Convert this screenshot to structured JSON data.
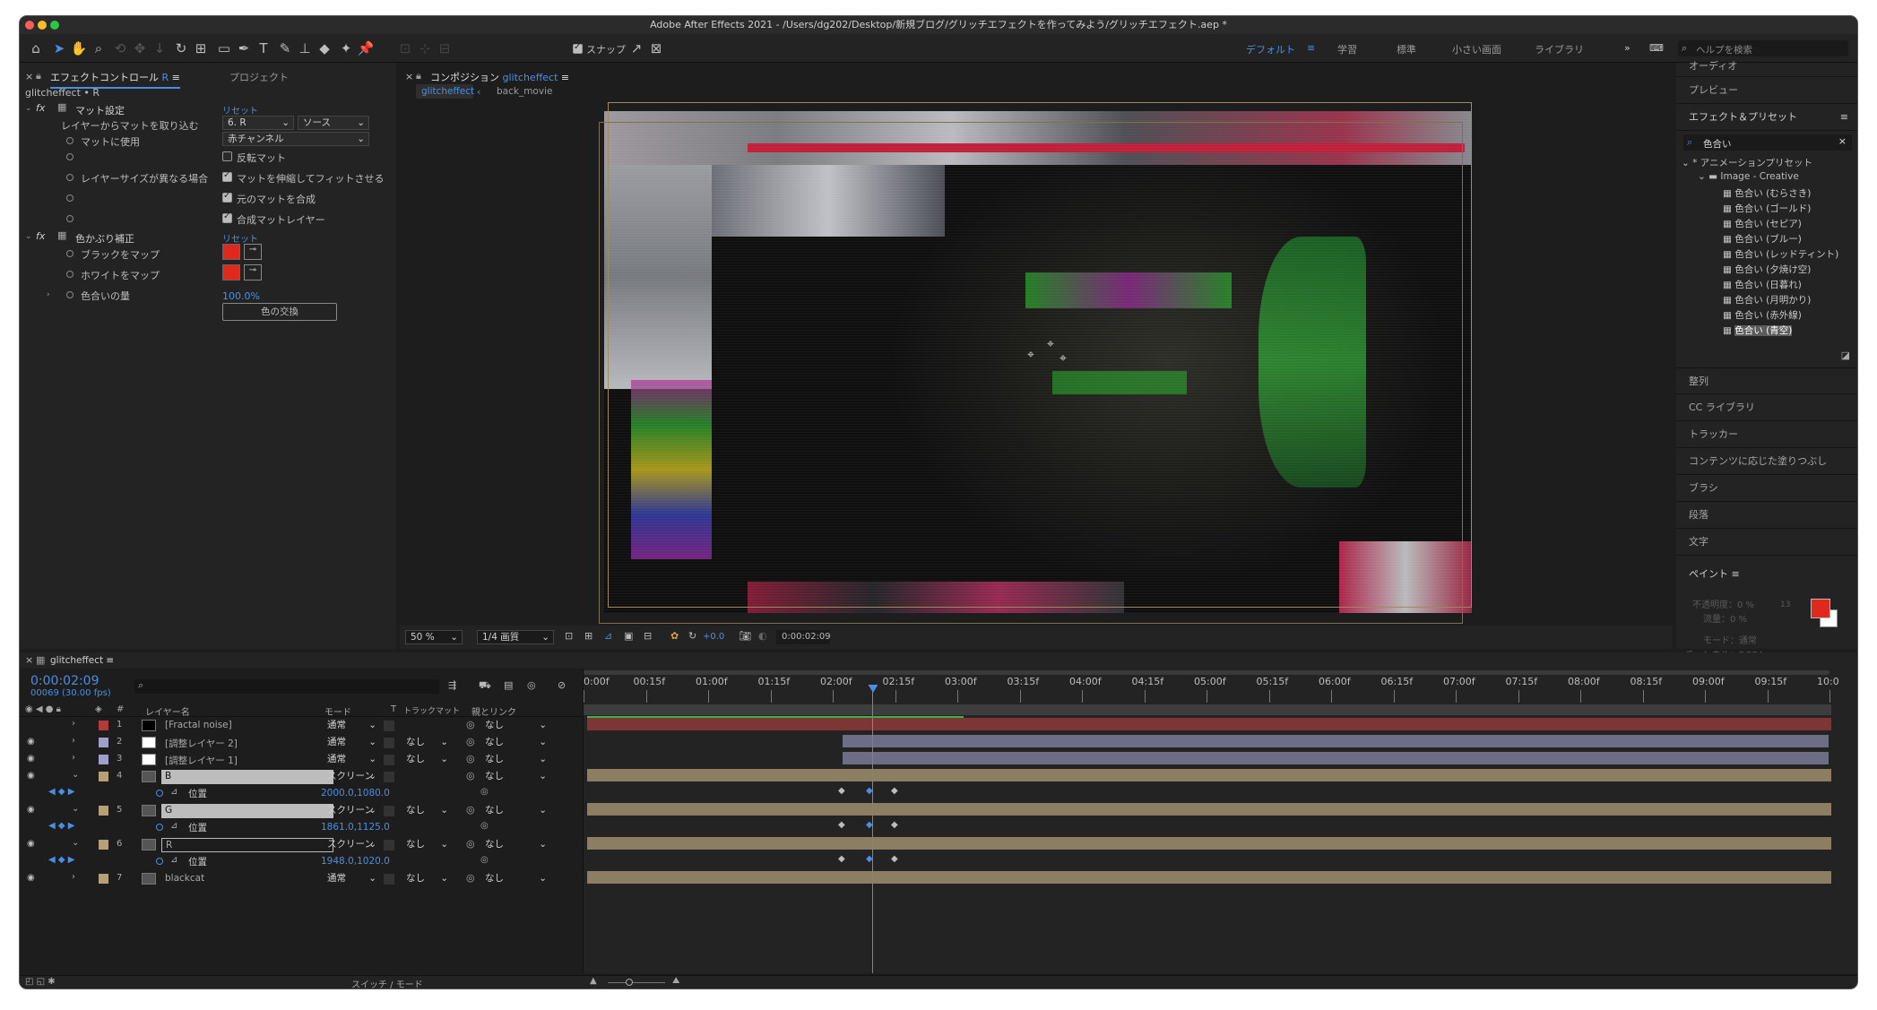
{
  "app": {
    "title": "Adobe After Effects 2021 - /Users/dg202/Desktop/新規ブログ/グリッチエフェクトを作ってみよう/グリッチエフェクト.aep *"
  },
  "toolbar": {
    "snap_label": "スナップ",
    "workspaces": [
      "デフォルト",
      "学習",
      "標準",
      "小さい画面",
      "ライブラリ"
    ],
    "help_placeholder": "ヘルプを検索"
  },
  "effect_controls": {
    "tab_label": "エフェクトコントロール",
    "tab_suffix": "R",
    "project_tab": "プロジェクト",
    "layer_path": "glitcheffect • R",
    "effect1": {
      "name": "マット設定",
      "reset": "リセット",
      "take_matte_label": "レイヤーからマットを取り込む",
      "take_matte_value": "6. R",
      "source_value": "ソース",
      "use_label": "マットに使用",
      "use_value": "赤チャンネル",
      "invert_label": "反転マット",
      "size_label": "レイヤーサイズが異なる場合",
      "stretch_label": "マットを伸縮してフィットさせる",
      "composite_label": "元のマットを合成",
      "premult_label": "合成マットレイヤー"
    },
    "effect2": {
      "name": "色かぶり補正",
      "reset": "リセット",
      "black_label": "ブラックをマップ",
      "white_label": "ホワイトをマップ",
      "amount_label": "色合いの量",
      "amount_value": "100.0%",
      "swap_label": "色の交換"
    },
    "map_color": "#e0281c"
  },
  "composition": {
    "tab_label": "コンポジション",
    "tab_name": "glitcheffect",
    "crumb_active": "glitcheffect",
    "crumb_next": "back_movie",
    "zoom": "50 %",
    "resolution": "1/4 画質",
    "exposure": "+0.0",
    "timecode": "0:00:02:09"
  },
  "right_panel": {
    "audio": "オーディオ",
    "preview": "プレビュー",
    "effects_presets": "エフェクト＆プリセット",
    "search_value": "色合い",
    "anim_presets": "* アニメーションプリセット",
    "folder": "Image - Creative",
    "presets": [
      "色合い (むらさき)",
      "色合い (ゴールド)",
      "色合い (セピア)",
      "色合い (ブルー)",
      "色合い (レッドティント)",
      "色合い (夕焼け空)",
      "色合い (日暮れ)",
      "色合い (月明かり)",
      "色合い (赤外線)",
      "色合い (青空)"
    ],
    "panels": [
      "整列",
      "CC ライブラリ",
      "トラッカー",
      "コンテンツに応じた塗りつぶし",
      "ブラシ",
      "段落",
      "文字"
    ],
    "paint": "ペイント",
    "opacity_label": "不透明度：0 %",
    "flow_label": "流量：0 %",
    "mode_label": "モード：通常",
    "channel_label": "チャンネル：RGBA",
    "brush_size": "13"
  },
  "timeline": {
    "tab_label": "glitcheffect",
    "timecode": "0:00:02:09",
    "frames": "00069 (30.00 fps)",
    "col_layer": "レイヤー名",
    "col_mode": "モード",
    "col_t": "T",
    "col_track": "トラックマット",
    "col_parent": "親とリンク",
    "switch_mode": "スイッチ / モード",
    "ruler": [
      "0:00f",
      "00:15f",
      "01:00f",
      "01:15f",
      "02:00f",
      "02:15f",
      "03:00f",
      "03:15f",
      "04:00f",
      "04:15f",
      "05:00f",
      "05:15f",
      "06:00f",
      "06:15f",
      "07:00f",
      "07:15f",
      "08:00f",
      "08:15f",
      "09:00f",
      "09:15f",
      "10:0"
    ],
    "playhead_fraction": 0.232,
    "layers": [
      {
        "num": "1",
        "name": "[Fractal noise]",
        "mode": "通常",
        "track": "",
        "parent": "なし",
        "color": "#b13a3a"
      },
      {
        "num": "2",
        "name": "[調整レイヤー 2]",
        "mode": "通常",
        "track": "なし",
        "parent": "なし",
        "color": "#9f9fc8"
      },
      {
        "num": "3",
        "name": "[調整レイヤー 1]",
        "mode": "通常",
        "track": "なし",
        "parent": "なし",
        "color": "#9f9fc8"
      },
      {
        "num": "4",
        "name": "B",
        "mode": "スクリーン",
        "track": "",
        "parent": "なし",
        "color": "#b5a07a"
      },
      {
        "num": "5",
        "name": "G",
        "mode": "スクリーン",
        "track": "なし",
        "parent": "なし",
        "color": "#b5a07a"
      },
      {
        "num": "6",
        "name": "R",
        "mode": "スクリーン",
        "track": "なし",
        "parent": "なし",
        "color": "#b5a07a"
      },
      {
        "num": "7",
        "name": "blackcat",
        "mode": "通常",
        "track": "なし",
        "parent": "なし",
        "color": "#b5a07a"
      }
    ],
    "position_label": "位置",
    "positions": [
      "2000.0,1080.0",
      "1861.0,1125.0",
      "1948.0,1020.0"
    ]
  }
}
